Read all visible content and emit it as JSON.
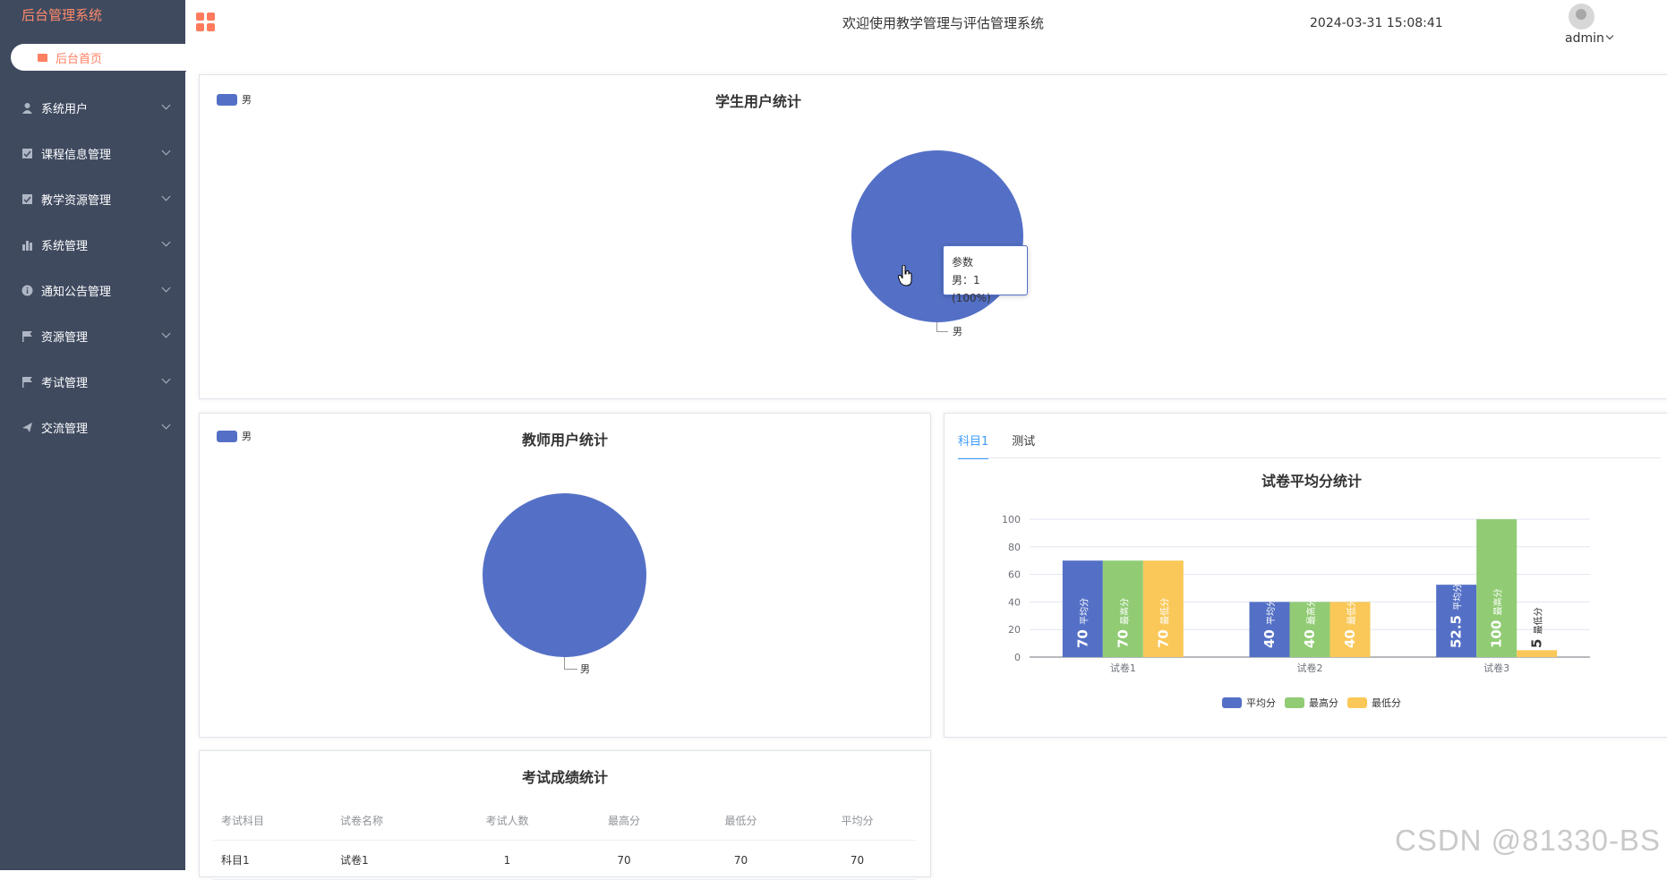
{
  "app": {
    "brand": "后台管理系统",
    "welcome": "欢迎使用教学管理与评估管理系统",
    "datetime": "2024-03-31 15:08:41",
    "user": "admin"
  },
  "colors": {
    "sidebar": "#3f4a5f",
    "accent": "#ff7f63",
    "blue": "#5470c6",
    "green": "#91cc75",
    "yellow": "#fac858"
  },
  "sidebar": {
    "home": "后台首页",
    "items": [
      {
        "label": "系统用户",
        "icon": "user-icon"
      },
      {
        "label": "课程信息管理",
        "icon": "checkbox-icon"
      },
      {
        "label": "教学资源管理",
        "icon": "checkbox-icon"
      },
      {
        "label": "系统管理",
        "icon": "bar-chart-icon"
      },
      {
        "label": "通知公告管理",
        "icon": "info-icon"
      },
      {
        "label": "资源管理",
        "icon": "flag-icon"
      },
      {
        "label": "考试管理",
        "icon": "flag-icon"
      },
      {
        "label": "交流管理",
        "icon": "send-icon"
      }
    ]
  },
  "student_card": {
    "title": "学生用户统计",
    "legend": "男",
    "slice_label": "男",
    "tooltip_title": "参数",
    "tooltip_value": "男：1 (100%)"
  },
  "teacher_card": {
    "title": "教师用户统计",
    "legend": "男",
    "slice_label": "男"
  },
  "score_card": {
    "tabs": [
      "科目1",
      "测试"
    ],
    "active_tab": 0
  },
  "chart_data": [
    {
      "type": "pie",
      "title": "学生用户统计",
      "categories": [
        "男"
      ],
      "values": [
        1
      ],
      "legend_position": "top-left"
    },
    {
      "type": "pie",
      "title": "教师用户统计",
      "categories": [
        "男"
      ],
      "values": [
        1
      ],
      "legend_position": "top-left"
    },
    {
      "type": "bar",
      "title": "试卷平均分统计",
      "categories": [
        "试卷1",
        "试卷2",
        "试卷3"
      ],
      "series": [
        {
          "name": "平均分",
          "values": [
            70,
            40,
            52.5
          ]
        },
        {
          "name": "最高分",
          "values": [
            70,
            40,
            100
          ]
        },
        {
          "name": "最低分",
          "values": [
            70,
            40,
            5
          ]
        }
      ],
      "ylim": [
        0,
        100
      ],
      "yticks": [
        0,
        20,
        40,
        60,
        80,
        100
      ],
      "grid": true,
      "legend_position": "bottom"
    }
  ],
  "exam_table": {
    "title": "考试成绩统计",
    "headers": [
      "考试科目",
      "试卷名称",
      "考试人数",
      "最高分",
      "最低分",
      "平均分"
    ],
    "rows": [
      [
        "科目1",
        "试卷1",
        "1",
        "70",
        "70",
        "70"
      ]
    ]
  },
  "watermark": "CSDN @81330-BS"
}
